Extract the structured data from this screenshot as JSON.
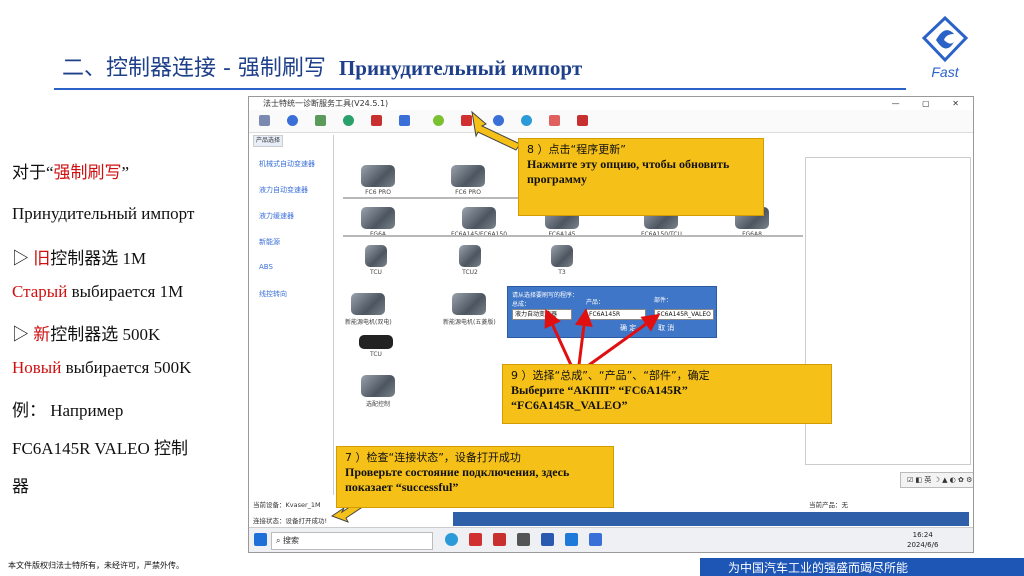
{
  "slide": {
    "title_cn": "二、控制器连接 - 强制刷写",
    "title_ru": "Принудительный импорт",
    "logo_text": "Fast",
    "footer_left": "本文件版权归法士特所有，未经许可，严禁外传。",
    "footer_right": "为中国汽车工业的强盛而竭尽所能"
  },
  "left_text": {
    "l1_a": "对于“",
    "l1_b": "强制刷写",
    "l1_c": "”",
    "l2": "Принудительный импорт",
    "l3_a": "▷  ",
    "l3_b": "旧",
    "l3_c": "控制器选 1M",
    "l4_a": "Старый",
    "l4_b": " выбирается 1M",
    "l5_a": "▷  ",
    "l5_b": "新",
    "l5_c": "控制器选 500K",
    "l6_a": "Новый",
    "l6_b": " выбирается 500K",
    "l7": "例：     Например",
    "l8": "FC6A145R VALEO 控制",
    "l9": "器"
  },
  "window": {
    "title": "法士特统一诊断服务工具(V24.5.1)",
    "controls": "— ▢ ✕",
    "sidebar_header": "产品选择",
    "sidebar_items": [
      "机械式自动变速器",
      "液力自动变速器",
      "液力缓速器",
      "新能源",
      "ABS",
      "线控转向"
    ],
    "products": [
      {
        "label": "FC6 PRO"
      },
      {
        "label": "FC6 PRO"
      },
      {
        "label": "FG6A"
      },
      {
        "label": "FC6A145/FC6A150"
      },
      {
        "label": "FC6A145"
      },
      {
        "label": "FC6A150/TCU"
      },
      {
        "label": "FG6A8"
      },
      {
        "label": "TCU"
      },
      {
        "label": "TCU2"
      },
      {
        "label": "T3"
      },
      {
        "label": "新能源电机(双电)"
      },
      {
        "label": "新能源电机(五菱版)"
      },
      {
        "label": "TCU"
      },
      {
        "label": "选配控制"
      }
    ],
    "dialog": {
      "label1": "请从选择要刷写的程序：",
      "label1b": "总成：",
      "label2": "产品：",
      "label3": "部件：",
      "sel1": "液力自动变速器",
      "sel2": "FC6A145R",
      "sel3": "FC6A145R_VALEO",
      "ok": "确 定",
      "cancel": "取 消"
    },
    "status_current": "当前设备：Kvaser_1M",
    "status_connect": "连接状态：设备打开成功!",
    "status_product": "当前产品：无",
    "taskbar_search": "搜索",
    "clock_time": "16:24",
    "clock_date": "2024/6/6"
  },
  "callouts": {
    "c8_cn": "8 ）点击“程序更新”",
    "c8_ru": "Нажмите эту опцию, чтобы обновить программу",
    "c9_cn": "9 ）选择“总成”、“产品”、“部件”，确定",
    "c9_ru1": "Выберите “АКПП” “FC6A145R”",
    "c9_ru2": "“FC6A145R_VALEO”",
    "c7_cn": "7 ）检查“连接状态”，设备打开成功",
    "c7_ru": "Проверьте состояние подключения, здесь показает “successful”"
  },
  "colors": {
    "title": "#1e3f8a",
    "accent_blue": "#2a62c8",
    "callout_yellow": "#f5c018",
    "arrow_red": "#e01010",
    "footer_blue": "#1e56b6"
  }
}
